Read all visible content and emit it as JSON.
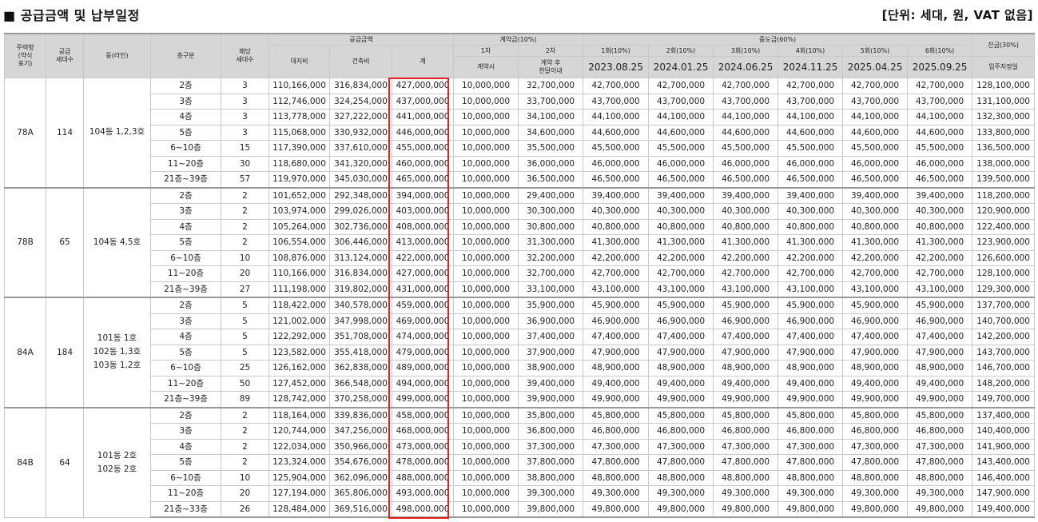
{
  "title": "■ 공급금액 및 납부일정",
  "unit": "[단위: 세대, 원, VAT 없음]",
  "header": {
    "housing_type": [
      "주택형",
      "(약식",
      "표기)"
    ],
    "supply_units": [
      "공급",
      "세대수"
    ],
    "dong_line": "동(라인)",
    "floor_group": "층구분",
    "units": [
      "해당",
      "세대수"
    ],
    "supply_amount": "공급금액",
    "land": "대지비",
    "building": "건축비",
    "total": "계",
    "contract": "계약금(10%)",
    "c1": "1차",
    "c2": "2차",
    "c1_when": "계약시",
    "c2_when": [
      "계약 후",
      "한달이내"
    ],
    "middle": "중도금(60%)",
    "m_labels": [
      "1회(10%)",
      "2회(10%)",
      "3회(10%)",
      "4회(10%)",
      "5회(10%)",
      "6회(10%)"
    ],
    "m_dates": [
      "2023.08.25",
      "2024.01.25",
      "2024.06.25",
      "2024.11.25",
      "2025.04.25",
      "2025.09.25"
    ],
    "balance": "잔금(30%)",
    "balance_when": "입주지정일"
  },
  "groups": [
    {
      "type": "78A",
      "supply": "114",
      "dong": [
        "104동 1,2,3호"
      ],
      "rows": [
        {
          "floor": "2층",
          "units": "3",
          "land": "110,166,000",
          "build": "316,834,000",
          "total": "427,000,000",
          "c1": "10,000,000",
          "c2": "32,700,000",
          "mid": "42,700,000",
          "bal": "128,100,000"
        },
        {
          "floor": "3층",
          "units": "3",
          "land": "112,746,000",
          "build": "324,254,000",
          "total": "437,000,000",
          "c1": "10,000,000",
          "c2": "33,700,000",
          "mid": "43,700,000",
          "bal": "131,100,000"
        },
        {
          "floor": "4층",
          "units": "3",
          "land": "113,778,000",
          "build": "327,222,000",
          "total": "441,000,000",
          "c1": "10,000,000",
          "c2": "34,100,000",
          "mid": "44,100,000",
          "bal": "132,300,000"
        },
        {
          "floor": "5층",
          "units": "3",
          "land": "115,068,000",
          "build": "330,932,000",
          "total": "446,000,000",
          "c1": "10,000,000",
          "c2": "34,600,000",
          "mid": "44,600,000",
          "bal": "133,800,000"
        },
        {
          "floor": "6~10층",
          "units": "15",
          "land": "117,390,000",
          "build": "337,610,000",
          "total": "455,000,000",
          "c1": "10,000,000",
          "c2": "35,500,000",
          "mid": "45,500,000",
          "bal": "136,500,000"
        },
        {
          "floor": "11~20층",
          "units": "30",
          "land": "118,680,000",
          "build": "341,320,000",
          "total": "460,000,000",
          "c1": "10,000,000",
          "c2": "36,000,000",
          "mid": "46,000,000",
          "bal": "138,000,000"
        },
        {
          "floor": "21층~39층",
          "units": "57",
          "land": "119,970,000",
          "build": "345,030,000",
          "total": "465,000,000",
          "c1": "10,000,000",
          "c2": "36,500,000",
          "mid": "46,500,000",
          "bal": "139,500,000"
        }
      ]
    },
    {
      "type": "78B",
      "supply": "65",
      "dong": [
        "104동 4,5호"
      ],
      "rows": [
        {
          "floor": "2층",
          "units": "2",
          "land": "101,652,000",
          "build": "292,348,000",
          "total": "394,000,000",
          "c1": "10,000,000",
          "c2": "29,400,000",
          "mid": "39,400,000",
          "bal": "118,200,000"
        },
        {
          "floor": "3층",
          "units": "2",
          "land": "103,974,000",
          "build": "299,026,000",
          "total": "403,000,000",
          "c1": "10,000,000",
          "c2": "30,300,000",
          "mid": "40,300,000",
          "bal": "120,900,000"
        },
        {
          "floor": "4층",
          "units": "2",
          "land": "105,264,000",
          "build": "302,736,000",
          "total": "408,000,000",
          "c1": "10,000,000",
          "c2": "30,800,000",
          "mid": "40,800,000",
          "bal": "122,400,000"
        },
        {
          "floor": "5층",
          "units": "2",
          "land": "106,554,000",
          "build": "306,446,000",
          "total": "413,000,000",
          "c1": "10,000,000",
          "c2": "31,300,000",
          "mid": "41,300,000",
          "bal": "123,900,000"
        },
        {
          "floor": "6~10층",
          "units": "10",
          "land": "108,876,000",
          "build": "313,124,000",
          "total": "422,000,000",
          "c1": "10,000,000",
          "c2": "32,200,000",
          "mid": "42,200,000",
          "bal": "126,600,000"
        },
        {
          "floor": "11~20층",
          "units": "20",
          "land": "110,166,000",
          "build": "316,834,000",
          "total": "427,000,000",
          "c1": "10,000,000",
          "c2": "32,700,000",
          "mid": "42,700,000",
          "bal": "128,100,000"
        },
        {
          "floor": "21층~39층",
          "units": "27",
          "land": "111,198,000",
          "build": "319,802,000",
          "total": "431,000,000",
          "c1": "10,000,000",
          "c2": "33,100,000",
          "mid": "43,100,000",
          "bal": "129,300,000"
        }
      ]
    },
    {
      "type": "84A",
      "supply": "184",
      "dong": [
        "101동 1호",
        "102동 1,3호",
        "103동 1,2호"
      ],
      "rows": [
        {
          "floor": "2층",
          "units": "5",
          "land": "118,422,000",
          "build": "340,578,000",
          "total": "459,000,000",
          "c1": "10,000,000",
          "c2": "35,900,000",
          "mid": "45,900,000",
          "bal": "137,700,000"
        },
        {
          "floor": "3층",
          "units": "5",
          "land": "121,002,000",
          "build": "347,998,000",
          "total": "469,000,000",
          "c1": "10,000,000",
          "c2": "36,900,000",
          "mid": "46,900,000",
          "bal": "140,700,000"
        },
        {
          "floor": "4층",
          "units": "5",
          "land": "122,292,000",
          "build": "351,708,000",
          "total": "474,000,000",
          "c1": "10,000,000",
          "c2": "37,400,000",
          "mid": "47,400,000",
          "bal": "142,200,000"
        },
        {
          "floor": "5층",
          "units": "5",
          "land": "123,582,000",
          "build": "355,418,000",
          "total": "479,000,000",
          "c1": "10,000,000",
          "c2": "37,900,000",
          "mid": "47,900,000",
          "bal": "143,700,000"
        },
        {
          "floor": "6~10층",
          "units": "25",
          "land": "126,162,000",
          "build": "362,838,000",
          "total": "489,000,000",
          "c1": "10,000,000",
          "c2": "38,900,000",
          "mid": "48,900,000",
          "bal": "146,700,000"
        },
        {
          "floor": "11~20층",
          "units": "50",
          "land": "127,452,000",
          "build": "366,548,000",
          "total": "494,000,000",
          "c1": "10,000,000",
          "c2": "39,400,000",
          "mid": "49,400,000",
          "bal": "148,200,000"
        },
        {
          "floor": "21층~39층",
          "units": "89",
          "land": "128,742,000",
          "build": "370,258,000",
          "total": "499,000,000",
          "c1": "10,000,000",
          "c2": "39,900,000",
          "mid": "49,900,000",
          "bal": "149,700,000"
        }
      ]
    },
    {
      "type": "84B",
      "supply": "64",
      "dong": [
        "101동 2호",
        "102동 2호"
      ],
      "rows": [
        {
          "floor": "2층",
          "units": "2",
          "land": "118,164,000",
          "build": "339,836,000",
          "total": "458,000,000",
          "c1": "10,000,000",
          "c2": "35,800,000",
          "mid": "45,800,000",
          "bal": "137,400,000"
        },
        {
          "floor": "3층",
          "units": "2",
          "land": "120,744,000",
          "build": "347,256,000",
          "total": "468,000,000",
          "c1": "10,000,000",
          "c2": "36,800,000",
          "mid": "46,800,000",
          "bal": "140,400,000"
        },
        {
          "floor": "4층",
          "units": "2",
          "land": "122,034,000",
          "build": "350,966,000",
          "total": "473,000,000",
          "c1": "10,000,000",
          "c2": "37,300,000",
          "mid": "47,300,000",
          "bal": "141,900,000"
        },
        {
          "floor": "5층",
          "units": "2",
          "land": "123,324,000",
          "build": "354,676,000",
          "total": "478,000,000",
          "c1": "10,000,000",
          "c2": "37,800,000",
          "mid": "47,800,000",
          "bal": "143,400,000"
        },
        {
          "floor": "6~10층",
          "units": "10",
          "land": "125,904,000",
          "build": "362,096,000",
          "total": "488,000,000",
          "c1": "10,000,000",
          "c2": "38,800,000",
          "mid": "48,800,000",
          "bal": "146,400,000"
        },
        {
          "floor": "11~20층",
          "units": "20",
          "land": "127,194,000",
          "build": "365,806,000",
          "total": "493,000,000",
          "c1": "10,000,000",
          "c2": "39,300,000",
          "mid": "49,300,000",
          "bal": "147,900,000"
        },
        {
          "floor": "21층~33층",
          "units": "26",
          "land": "128,484,000",
          "build": "369,516,000",
          "total": "498,000,000",
          "c1": "10,000,000",
          "c2": "39,800,000",
          "mid": "49,800,000",
          "bal": "149,400,000"
        }
      ]
    }
  ]
}
